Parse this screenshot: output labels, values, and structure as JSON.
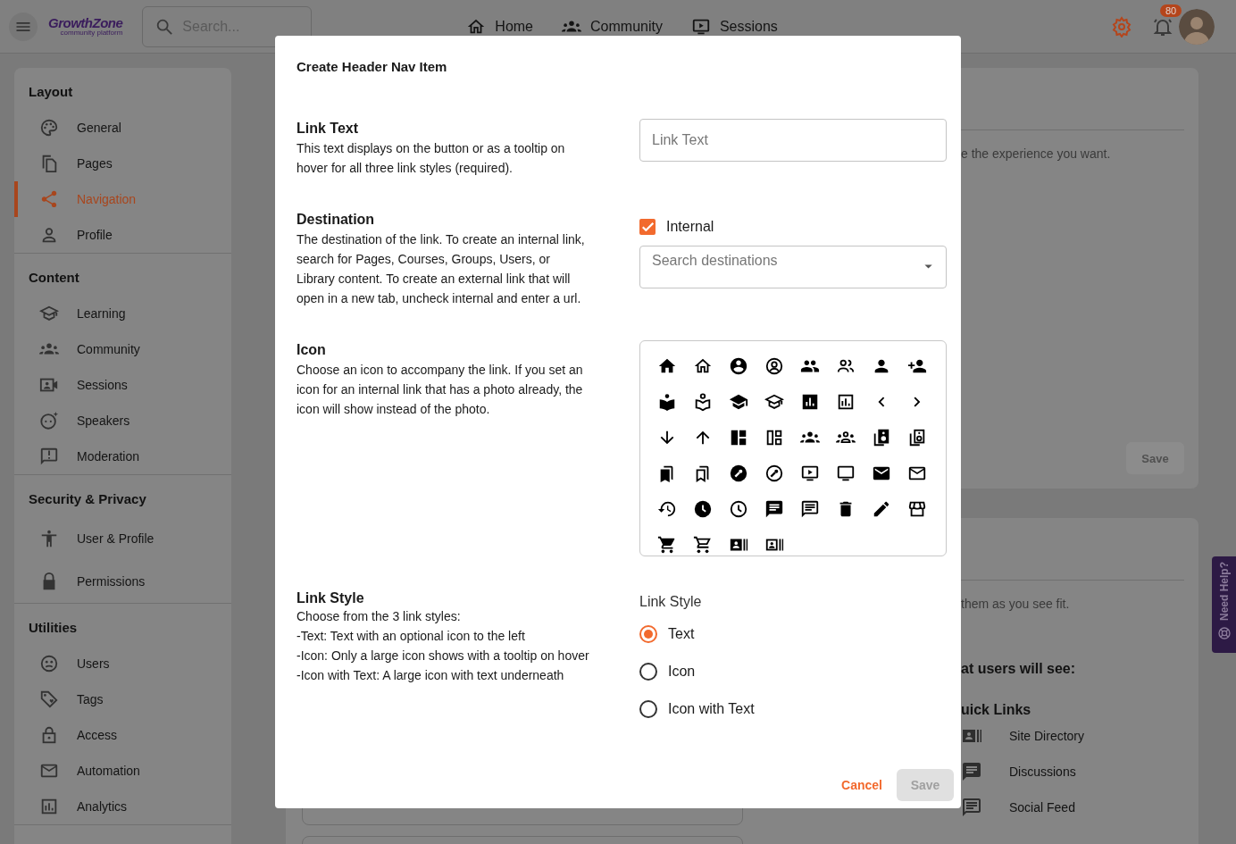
{
  "header": {
    "logo": "GrowthZone",
    "logo_tagline": "community platform",
    "search": {
      "placeholder": "Search..."
    },
    "nav": [
      {
        "label": "Home"
      },
      {
        "label": "Community"
      },
      {
        "label": "Sessions"
      }
    ],
    "notification_count": "80"
  },
  "sidebar": {
    "sections": [
      {
        "title": "Layout",
        "items": [
          {
            "label": "General",
            "selected": false
          },
          {
            "label": "Pages",
            "selected": false
          },
          {
            "label": "Navigation",
            "selected": true
          },
          {
            "label": "Profile",
            "selected": false
          }
        ]
      },
      {
        "title": "Content",
        "items": [
          {
            "label": "Learning",
            "selected": false
          },
          {
            "label": "Community",
            "selected": false
          },
          {
            "label": "Sessions",
            "selected": false
          },
          {
            "label": "Speakers",
            "selected": false
          },
          {
            "label": "Moderation",
            "selected": false
          }
        ]
      },
      {
        "title": "Security & Privacy",
        "items": [
          {
            "label": "User & Profile",
            "selected": false
          },
          {
            "label": "Permissions",
            "selected": false
          }
        ]
      },
      {
        "title": "Utilities",
        "items": [
          {
            "label": "Users",
            "selected": false
          },
          {
            "label": "Tags",
            "selected": false
          },
          {
            "label": "Access",
            "selected": false
          },
          {
            "label": "Automation",
            "selected": false
          },
          {
            "label": "Analytics",
            "selected": false
          }
        ]
      }
    ]
  },
  "background": {
    "card_1": {
      "description": "e the experience you want.",
      "button": "Save"
    },
    "card_2": {
      "description": "them as you see fit.",
      "heading": "at users will see:",
      "subheading": "uick Links",
      "links": [
        "Site Directory",
        "Discussions",
        "Social Feed"
      ]
    }
  },
  "help_tab": "Need Help?",
  "dialog": {
    "title": "Create Header Nav Item",
    "sections": [
      {
        "kind": "text_field",
        "title": "Link Text",
        "description": "This text displays on the button or as a tooltip on hover for all three link styles (required).",
        "placeholder": "Link Text"
      },
      {
        "kind": "destination",
        "title": "Destination",
        "description": "The destination of the link. To create an internal link, search for Pages, Courses, Groups, Users, or Library content. To create an external link that will open in a new tab, uncheck internal and enter a url.",
        "checkbox": {
          "label": "Internal",
          "checked": true
        },
        "placeholder": "Search destinations"
      },
      {
        "kind": "icon_picker",
        "title": "Icon",
        "description": "Choose an icon to accompany the link. If you set an icon for an internal link that has a photo already, the icon will show instead of the photo."
      },
      {
        "kind": "radio_group",
        "title": "Link Style",
        "description_lines": [
          "Choose from the 3 link styles:",
          "-Text: Text with an optional icon to the left",
          "-Icon: Only a large icon shows with a tooltip on hover",
          "-Icon with Text: A large icon with text underneath"
        ],
        "group_label": "Link Style",
        "options": [
          {
            "label": "Text",
            "selected": true
          },
          {
            "label": "Icon",
            "selected": false
          },
          {
            "label": "Icon with Text",
            "selected": false
          }
        ]
      }
    ],
    "buttons": {
      "cancel": "Cancel",
      "save": {
        "label": "Save",
        "disabled": true
      }
    }
  }
}
